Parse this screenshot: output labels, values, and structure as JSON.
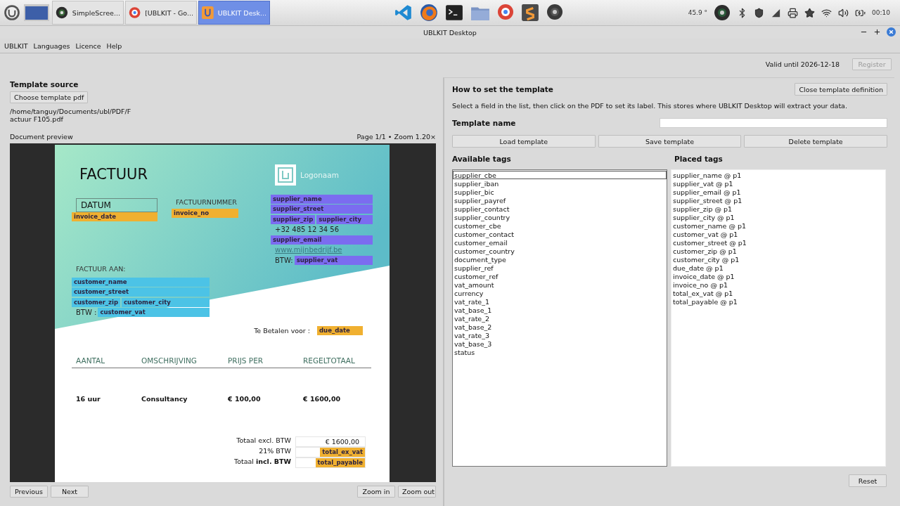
{
  "taskbar": {
    "apps": [
      {
        "label": "SimpleScree...",
        "selected": false
      },
      {
        "label": "[UBLKIT - Go...",
        "selected": false
      },
      {
        "label": "UBLKIT Desk...",
        "selected": true
      }
    ],
    "temperature": "45.9 °",
    "clock": "00:10"
  },
  "window": {
    "title": "UBLKIT Desktop"
  },
  "menu": [
    "UBLKIT",
    "Languages",
    "Licence",
    "Help"
  ],
  "license": {
    "text": "Valid until 2026-12-18",
    "register": {
      "label": "Register",
      "disabled": true
    }
  },
  "template_source": {
    "heading": "Template source",
    "choose_button": "Choose template pdf",
    "path_lines": [
      "/home/tanguy/Documents/ubl/PDF/F",
      "actuur F105.pdf"
    ],
    "preview_label": "Document preview",
    "page_info": "Page 1/1  •  Zoom 1.20×"
  },
  "document": {
    "title": "FACTUUR",
    "logo_text": "Logonaam",
    "date_label": "DATUM",
    "number_label": "FACTUURNUMMER",
    "date": {
      "kind": "tagged",
      "tag": "invoice_date",
      "color": "#f0b030"
    },
    "number": {
      "kind": "tagged",
      "tag": "invoice_no",
      "color": "#f0b030"
    },
    "supplier_rows": [
      [
        {
          "kind": "tagged",
          "tag": "supplier_name",
          "color": "#7b6cf0"
        }
      ],
      [
        {
          "kind": "tagged",
          "tag": "supplier_street",
          "color": "#7b6cf0"
        }
      ],
      [
        {
          "kind": "tagged",
          "tag": "supplier_zip",
          "color": "#7b6cf0"
        },
        {
          "kind": "tagged",
          "tag": "supplier_city",
          "color": "#7b6cf0"
        }
      ],
      [
        {
          "kind": "text",
          "text": "+32 485 12 34 56"
        }
      ],
      [
        {
          "kind": "tagged",
          "tag": "supplier_email",
          "color": "#7b6cf0"
        }
      ],
      [
        {
          "kind": "link",
          "text": "www.mijnbedrijf.be"
        }
      ],
      [
        {
          "kind": "text",
          "text": "BTW:"
        },
        {
          "kind": "tagged",
          "tag": "supplier_vat",
          "color": "#7b6cf0"
        }
      ]
    ],
    "customer_heading": "FACTUUR AAN:",
    "customer_rows": [
      [
        {
          "kind": "tagged",
          "tag": "customer_name",
          "color": "#4cc3e6"
        }
      ],
      [
        {
          "kind": "tagged",
          "tag": "customer_street",
          "color": "#4cc3e6"
        }
      ],
      [
        {
          "kind": "tagged",
          "tag": "customer_zip",
          "color": "#4cc3e6"
        },
        {
          "kind": "tagged",
          "tag": "customer_city",
          "color": "#4cc3e6"
        }
      ],
      [
        {
          "kind": "text",
          "text": "BTW :"
        },
        {
          "kind": "tagged",
          "tag": "customer_vat",
          "color": "#4cc3e6"
        }
      ]
    ],
    "due_label": "Te Betalen voor :",
    "due": {
      "kind": "tagged",
      "tag": "due_date",
      "color": "#f0b030"
    },
    "columns": [
      "AANTAL",
      "OMSCHRIJVING",
      "PRIJS PER",
      "REGELTOTAAL"
    ],
    "rows": [
      [
        "16 uur",
        "Consultancy",
        "€ 100,00",
        "€ 1600,00"
      ]
    ],
    "totals": [
      {
        "label": "Totaal excl. BTW",
        "value": {
          "kind": "text",
          "text": "€ 1600,00"
        }
      },
      {
        "label": "21% BTW",
        "value": {
          "kind": "tagged",
          "tag": "total_ex_vat",
          "color": "#f0b030"
        }
      },
      {
        "label": "Totaal **incl. BTW**",
        "value": {
          "kind": "tagged",
          "tag": "total_payable",
          "color": "#f0b030"
        }
      }
    ]
  },
  "nav": {
    "previous": "Previous",
    "next": "Next",
    "zoom_in": "Zoom in",
    "zoom_out": "Zoom out"
  },
  "definition": {
    "heading": "How to set the template",
    "close_button": "Close template definition",
    "instructions": "Select a field in the list, then click on the PDF to set its label. This stores where UBLKIT Desktop will extract your data.",
    "name_label": "Template name",
    "buttons": [
      "Load template",
      "Save template",
      "Delete template"
    ],
    "available_heading": "Available tags",
    "placed_heading": "Placed tags",
    "available": [
      {
        "label": "supplier_cbe",
        "selected": true
      },
      {
        "label": "supplier_iban",
        "selected": false
      },
      {
        "label": "supplier_bic",
        "selected": false
      },
      {
        "label": "supplier_payref",
        "selected": false
      },
      {
        "label": "supplier_contact",
        "selected": false
      },
      {
        "label": "supplier_country",
        "selected": false
      },
      {
        "label": "customer_cbe",
        "selected": false
      },
      {
        "label": "customer_contact",
        "selected": false
      },
      {
        "label": "customer_email",
        "selected": false
      },
      {
        "label": "customer_country",
        "selected": false
      },
      {
        "label": "document_type",
        "selected": false
      },
      {
        "label": "supplier_ref",
        "selected": false
      },
      {
        "label": "customer_ref",
        "selected": false
      },
      {
        "label": "vat_amount",
        "selected": false
      },
      {
        "label": "currency",
        "selected": false
      },
      {
        "label": "vat_rate_1",
        "selected": false
      },
      {
        "label": "vat_base_1",
        "selected": false
      },
      {
        "label": "vat_rate_2",
        "selected": false
      },
      {
        "label": "vat_base_2",
        "selected": false
      },
      {
        "label": "vat_rate_3",
        "selected": false
      },
      {
        "label": "vat_base_3",
        "selected": false
      },
      {
        "label": "status",
        "selected": false
      }
    ],
    "placed": [
      {
        "label": "supplier_name @ p1",
        "selected": false
      },
      {
        "label": "supplier_vat @ p1",
        "selected": false
      },
      {
        "label": "supplier_email @ p1",
        "selected": false
      },
      {
        "label": "supplier_street @ p1",
        "selected": false
      },
      {
        "label": "supplier_zip @ p1",
        "selected": false
      },
      {
        "label": "supplier_city @ p1",
        "selected": false
      },
      {
        "label": "customer_name @ p1",
        "selected": false
      },
      {
        "label": "customer_vat @ p1",
        "selected": false
      },
      {
        "label": "customer_street @ p1",
        "selected": false
      },
      {
        "label": "customer_zip @ p1",
        "selected": false
      },
      {
        "label": "customer_city @ p1",
        "selected": false
      },
      {
        "label": "due_date @ p1",
        "selected": false
      },
      {
        "label": "invoice_date @ p1",
        "selected": false
      },
      {
        "label": "invoice_no @ p1",
        "selected": false
      },
      {
        "label": "total_ex_vat @ p1",
        "selected": false
      },
      {
        "label": "total_payable @ p1",
        "selected": false
      }
    ],
    "reset_button": "Reset"
  }
}
